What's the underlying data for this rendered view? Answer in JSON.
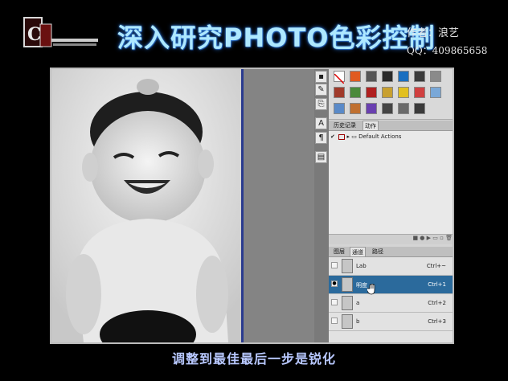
{
  "header": {
    "title": "深入研究PHOTO色彩控制",
    "author": "作者：浪艺",
    "qq": "QQ：409865658"
  },
  "caption": "调整到最佳最后一步是锐化",
  "history_panel": {
    "tabs": [
      "历史记录",
      "动作"
    ],
    "action_set": "Default Actions"
  },
  "channels_panel": {
    "tabs": [
      "图层",
      "通道",
      "路径"
    ],
    "channels": [
      {
        "name": "Lab",
        "shortcut": "Ctrl+~",
        "selected": false
      },
      {
        "name": "明度",
        "shortcut": "Ctrl+1",
        "selected": true
      },
      {
        "name": "a",
        "shortcut": "Ctrl+2",
        "selected": false
      },
      {
        "name": "b",
        "shortcut": "Ctrl+3",
        "selected": false
      }
    ]
  },
  "colors": {
    "title_glow": "#aee8ff",
    "selected_row": "#2b6a9c",
    "caption": "#b8c8ff"
  }
}
